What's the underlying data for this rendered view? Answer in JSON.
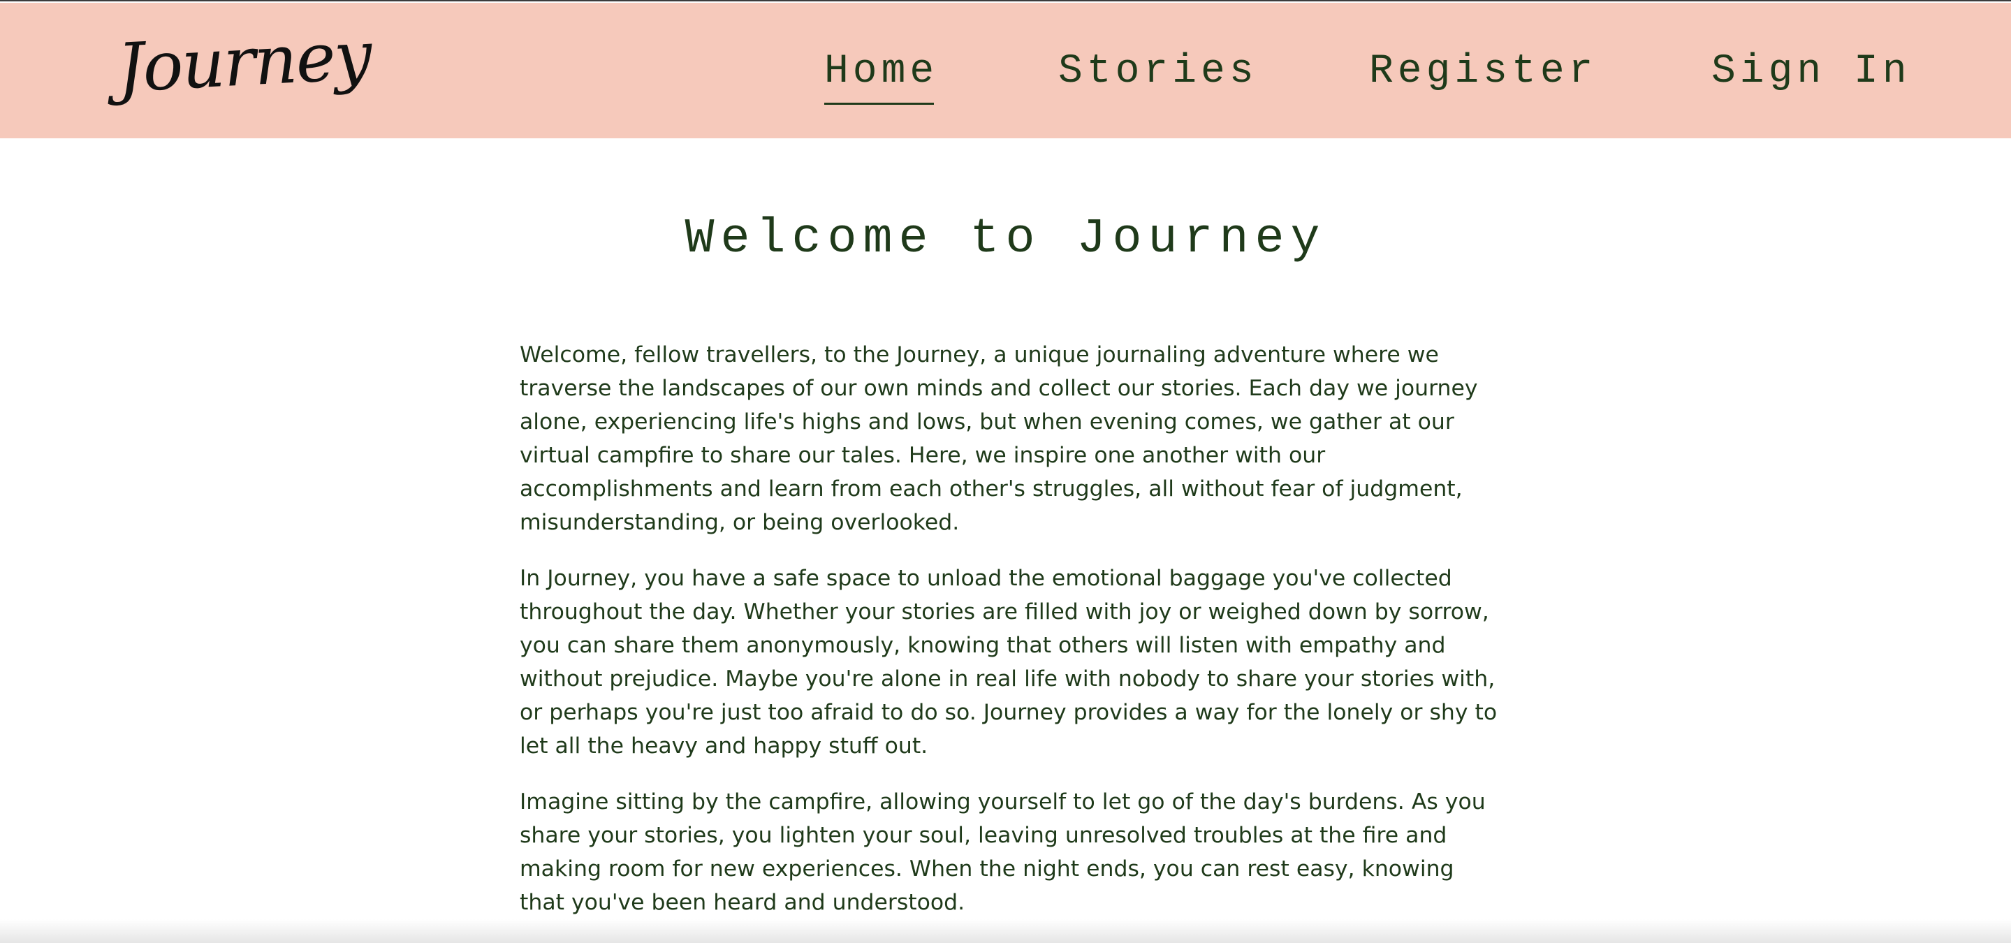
{
  "header": {
    "logo_text": "Journey",
    "background_color": "#f6c9bb",
    "text_color": "#1f3a1a",
    "nav": [
      {
        "label": "Home",
        "active": true
      },
      {
        "label": "Stories",
        "active": false
      },
      {
        "label": "Register",
        "active": false
      },
      {
        "label": "Sign In",
        "active": false
      }
    ]
  },
  "main": {
    "title": "Welcome to Journey",
    "paragraphs": [
      "Welcome, fellow travellers, to the Journey, a unique journaling adventure where we traverse the landscapes of our own minds and collect our stories. Each day we journey alone, experiencing life's highs and lows, but when evening comes, we gather at our virtual campfire to share our tales. Here, we inspire one another with our accomplishments and learn from each other's struggles, all without fear of judgment, misunderstanding, or being overlooked.",
      "In Journey, you have a safe space to unload the emotional baggage you've collected throughout the day. Whether your stories are filled with joy or weighed down by sorrow, you can share them anonymously, knowing that others will listen with empathy and without prejudice. Maybe you're alone in real life with nobody to share your stories with, or perhaps you're just too afraid to do so. Journey provides a way for the lonely or shy to let all the heavy and happy stuff out.",
      "Imagine sitting by the campfire, allowing yourself to let go of the day's burdens. As you share your stories, you lighten your soul, leaving unresolved troubles at the fire and making room for new experiences. When the night ends, you can rest easy, knowing that you've been heard and understood."
    ]
  }
}
